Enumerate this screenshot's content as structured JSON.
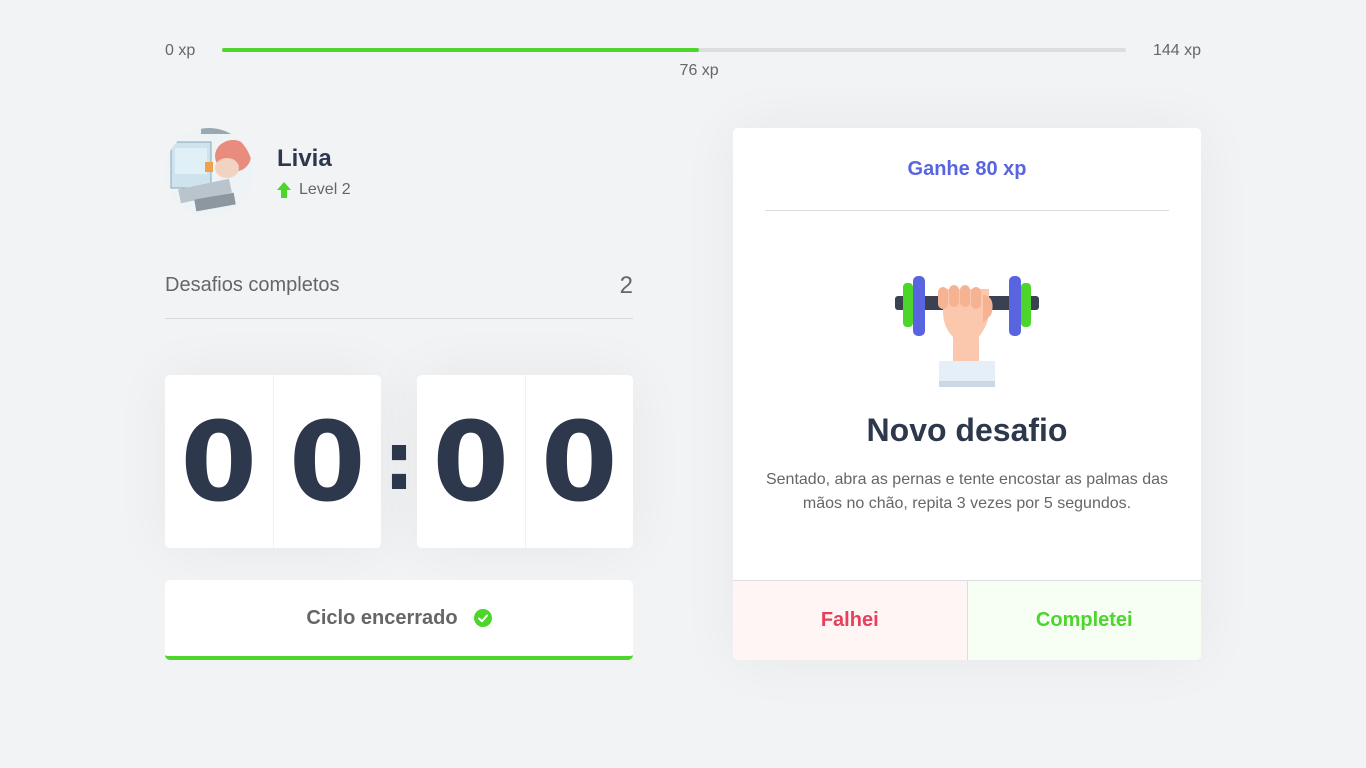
{
  "xp": {
    "min_label": "0 xp",
    "max_label": "144 xp",
    "current_label": "76 xp",
    "current": 76,
    "max": 144,
    "fill_color": "#4cd62b"
  },
  "profile": {
    "name": "Livia",
    "level_label": "Level 2",
    "level_icon": "level-up-arrow-icon"
  },
  "challenges": {
    "label": "Desafios completos",
    "count": "2"
  },
  "countdown": {
    "minute_left": "0",
    "minute_right": "0",
    "separator": ":",
    "second_left": "0",
    "second_right": "0"
  },
  "cycle_button": {
    "label": "Ciclo encerrado",
    "icon": "check-circle-icon"
  },
  "challenge_card": {
    "reward": "Ganhe 80 xp",
    "icon": "body-dumbbell-icon",
    "title": "Novo desafio",
    "description": "Sentado, abra as pernas e tente encostar as palmas das mãos no chão, repita 3 vezes por 5 segundos.",
    "fail_label": "Falhei",
    "success_label": "Completei"
  },
  "colors": {
    "accent_blue": "#5965e0",
    "success_green": "#4cd62b",
    "fail_red": "#e83f5b",
    "title_dark": "#2e384d",
    "background": "#f2f3f5"
  }
}
